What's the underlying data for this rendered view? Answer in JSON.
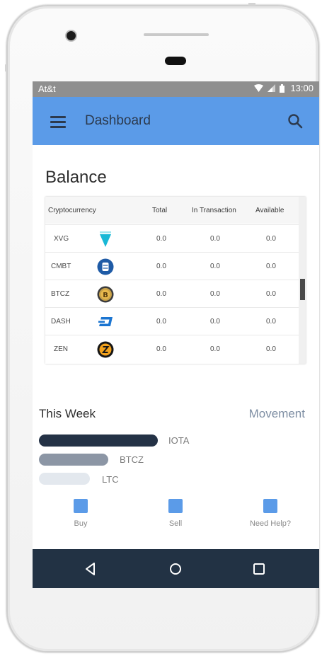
{
  "status_bar": {
    "carrier": "At&t",
    "time": "13:00",
    "icons": [
      "wifi-icon",
      "signal-icon",
      "battery-icon"
    ]
  },
  "app_bar": {
    "title": "Dashboard",
    "menu_icon": "hamburger-menu-icon",
    "search_icon": "search-icon"
  },
  "balance": {
    "title": "Balance",
    "columns": [
      "Cryptocurrency",
      "Total",
      "In Transaction",
      "Available"
    ],
    "rows": [
      {
        "symbol": "XVG",
        "icon": "verge-icon",
        "total": "0.0",
        "in_transaction": "0.0",
        "available": "0.0"
      },
      {
        "symbol": "CMBT",
        "icon": "cmbt-icon",
        "total": "0.0",
        "in_transaction": "0.0",
        "available": "0.0"
      },
      {
        "symbol": "BTCZ",
        "icon": "bitcoinz-icon",
        "total": "0.0",
        "in_transaction": "0.0",
        "available": "0.0"
      },
      {
        "symbol": "DASH",
        "icon": "dash-icon",
        "total": "0.0",
        "in_transaction": "0.0",
        "available": "0.0"
      },
      {
        "symbol": "ZEN",
        "icon": "zencash-icon",
        "total": "0.0",
        "in_transaction": "0.0",
        "available": "0.0"
      }
    ]
  },
  "this_week": {
    "title": "This Week",
    "movement_label": "Movement",
    "bars": [
      {
        "label": "IOTA",
        "color": "#243246"
      },
      {
        "label": "BTCZ",
        "color": "#8c96a5"
      },
      {
        "label": "LTC",
        "color": "#e3e8ee"
      }
    ]
  },
  "actions": [
    {
      "label": "Buy"
    },
    {
      "label": "Sell"
    },
    {
      "label": "Need Help?"
    }
  ],
  "nav_bar": {
    "buttons": [
      "back-icon",
      "home-icon",
      "recents-icon"
    ]
  },
  "colors": {
    "accent": "#5b9be8",
    "nav_bg": "#223244",
    "status_bg": "#8f8f8f"
  }
}
